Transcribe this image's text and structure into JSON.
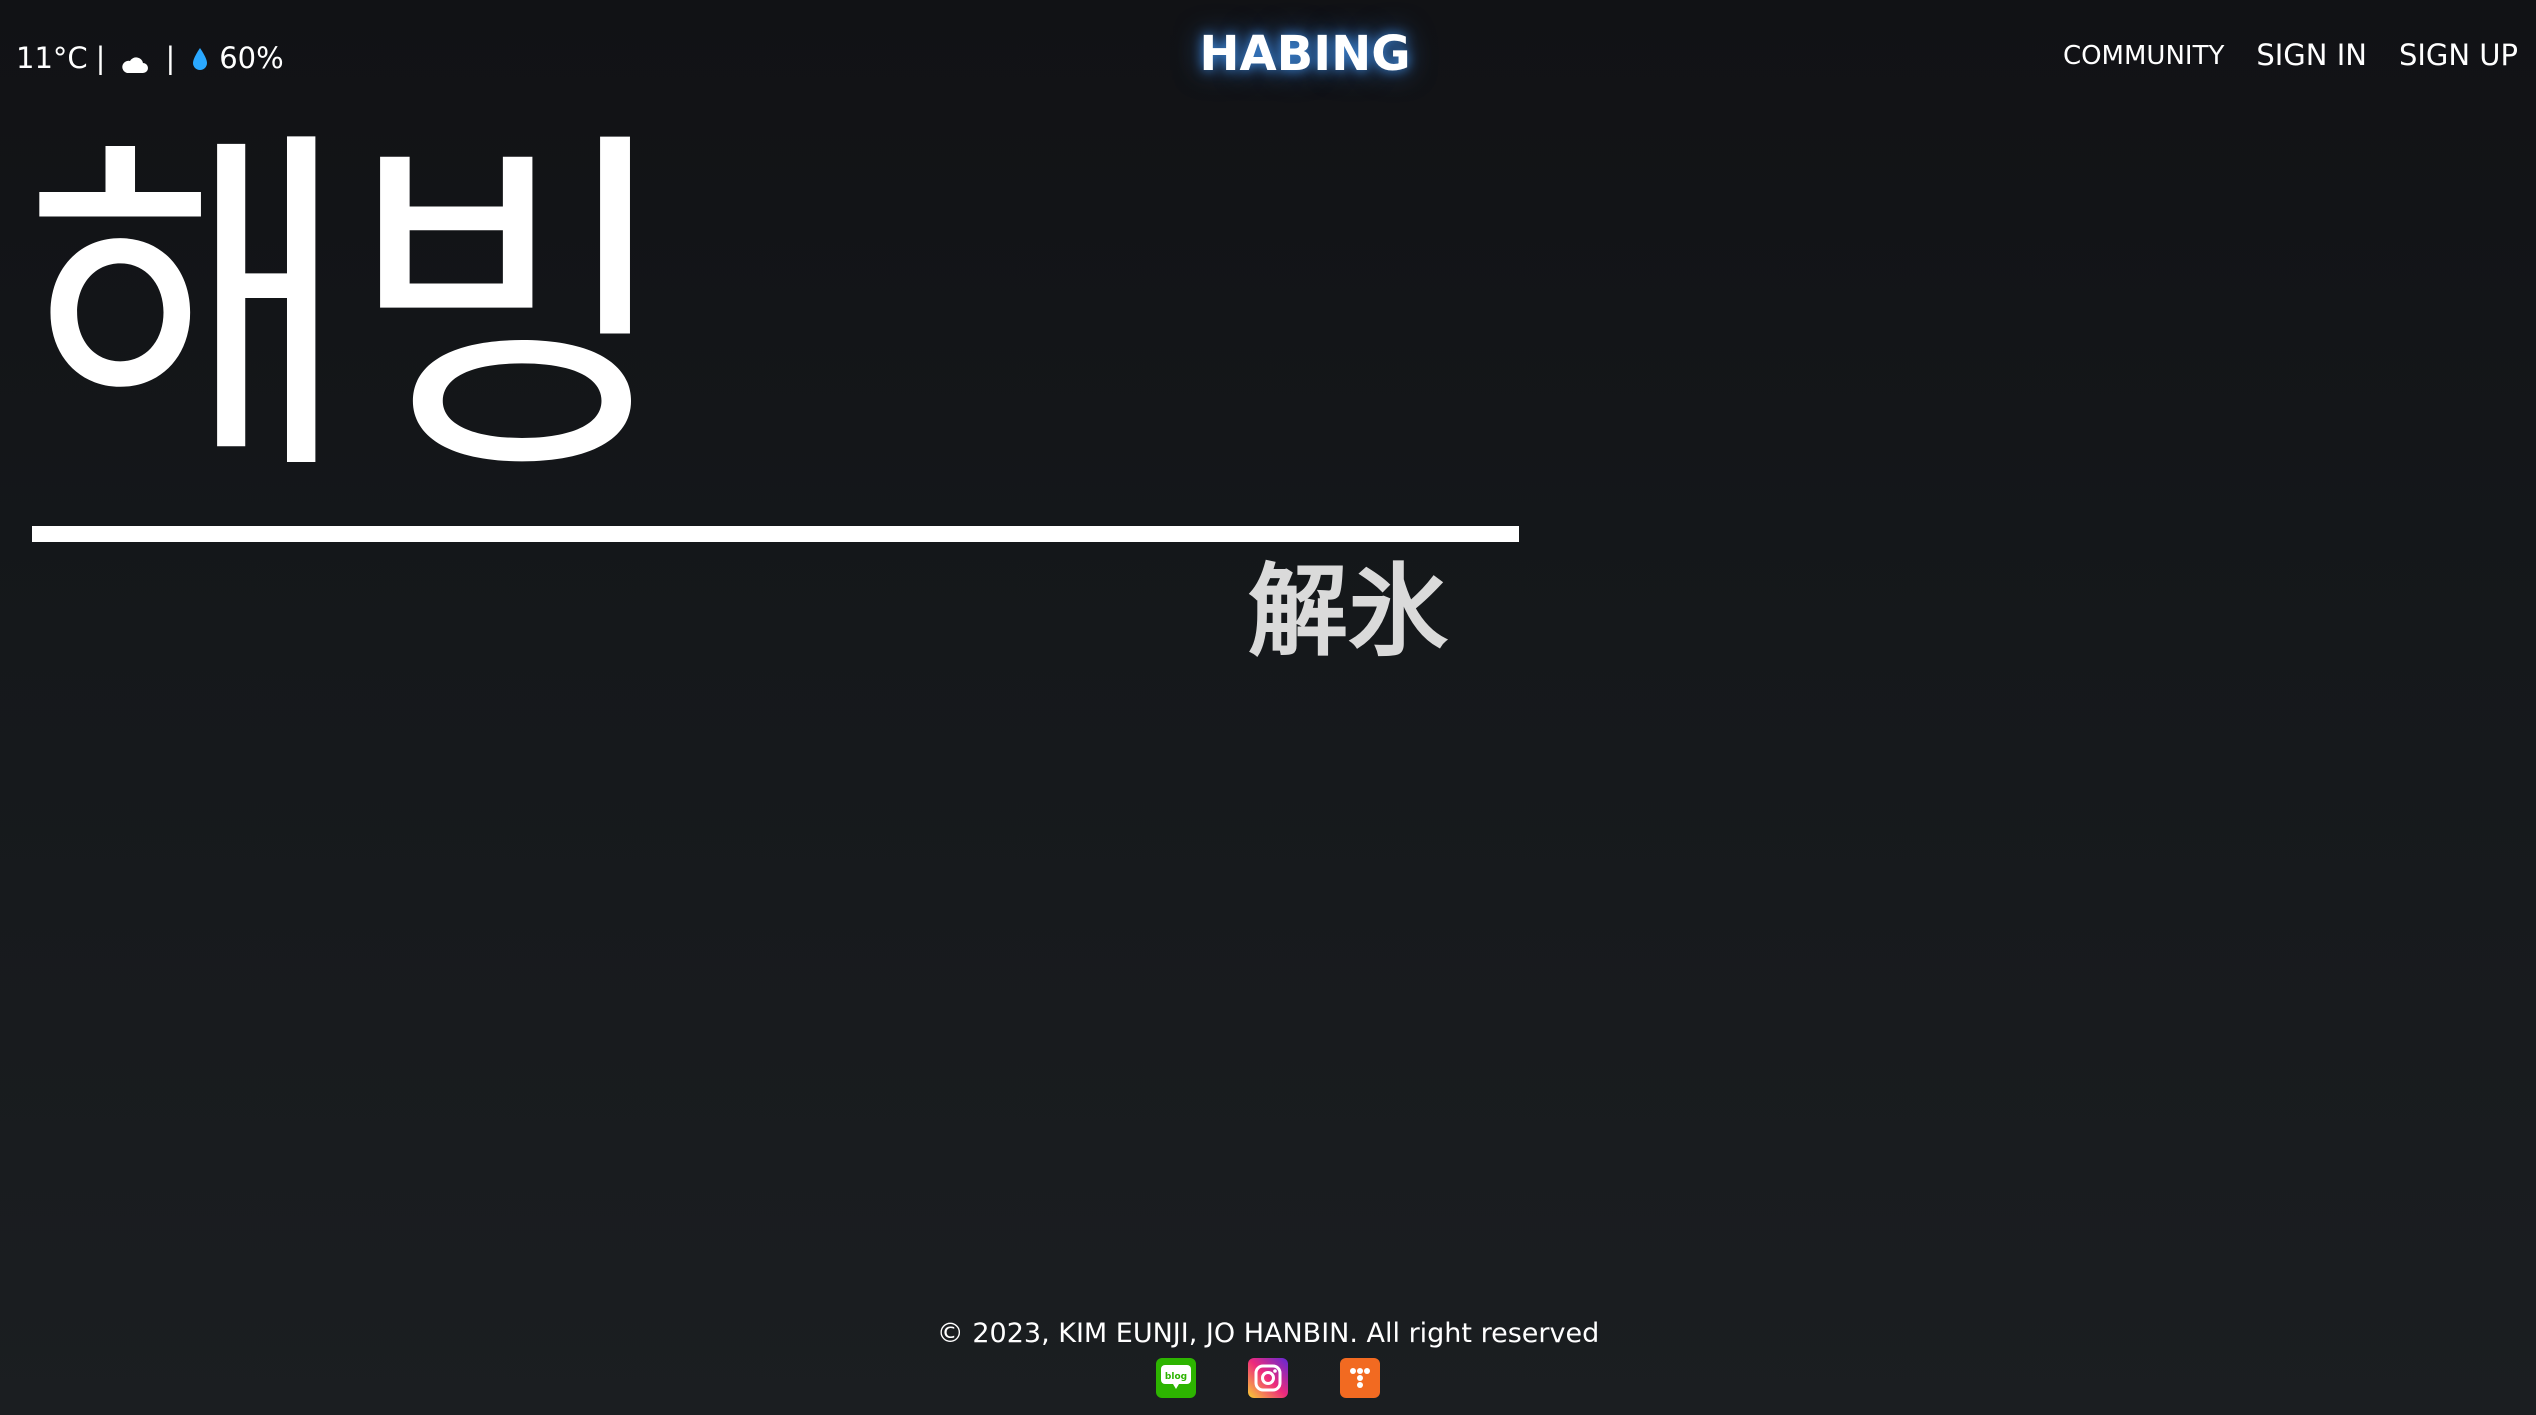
{
  "header": {
    "weather": {
      "temperature": "11°C",
      "separator": "|",
      "condition_icon": "cloud-icon",
      "humidity_icon": "water-drop-icon",
      "humidity": "60%"
    },
    "logo": "HABING",
    "nav": {
      "community": "COMMUNITY",
      "sign_in": "SIGN IN",
      "sign_up": "SIGN UP"
    }
  },
  "hero": {
    "title": "해빙",
    "subtitle": "解氷"
  },
  "footer": {
    "copyright": "© 2023, KIM EUNJI, JO HANBIN. All right reserved",
    "socials": [
      {
        "name": "blog",
        "icon": "blog-icon",
        "label": "blog",
        "color": "#2db400"
      },
      {
        "name": "instagram",
        "icon": "instagram-icon",
        "color": "#c13584"
      },
      {
        "name": "tistory",
        "icon": "tistory-icon",
        "color": "#f26a21"
      }
    ]
  },
  "colors": {
    "background_top": "#111215",
    "background_bottom": "#1b1e21",
    "text": "#ffffff",
    "subtitle": "#dadada",
    "logo_glow": "#46a0ff",
    "drop": "#2aa8ff"
  }
}
